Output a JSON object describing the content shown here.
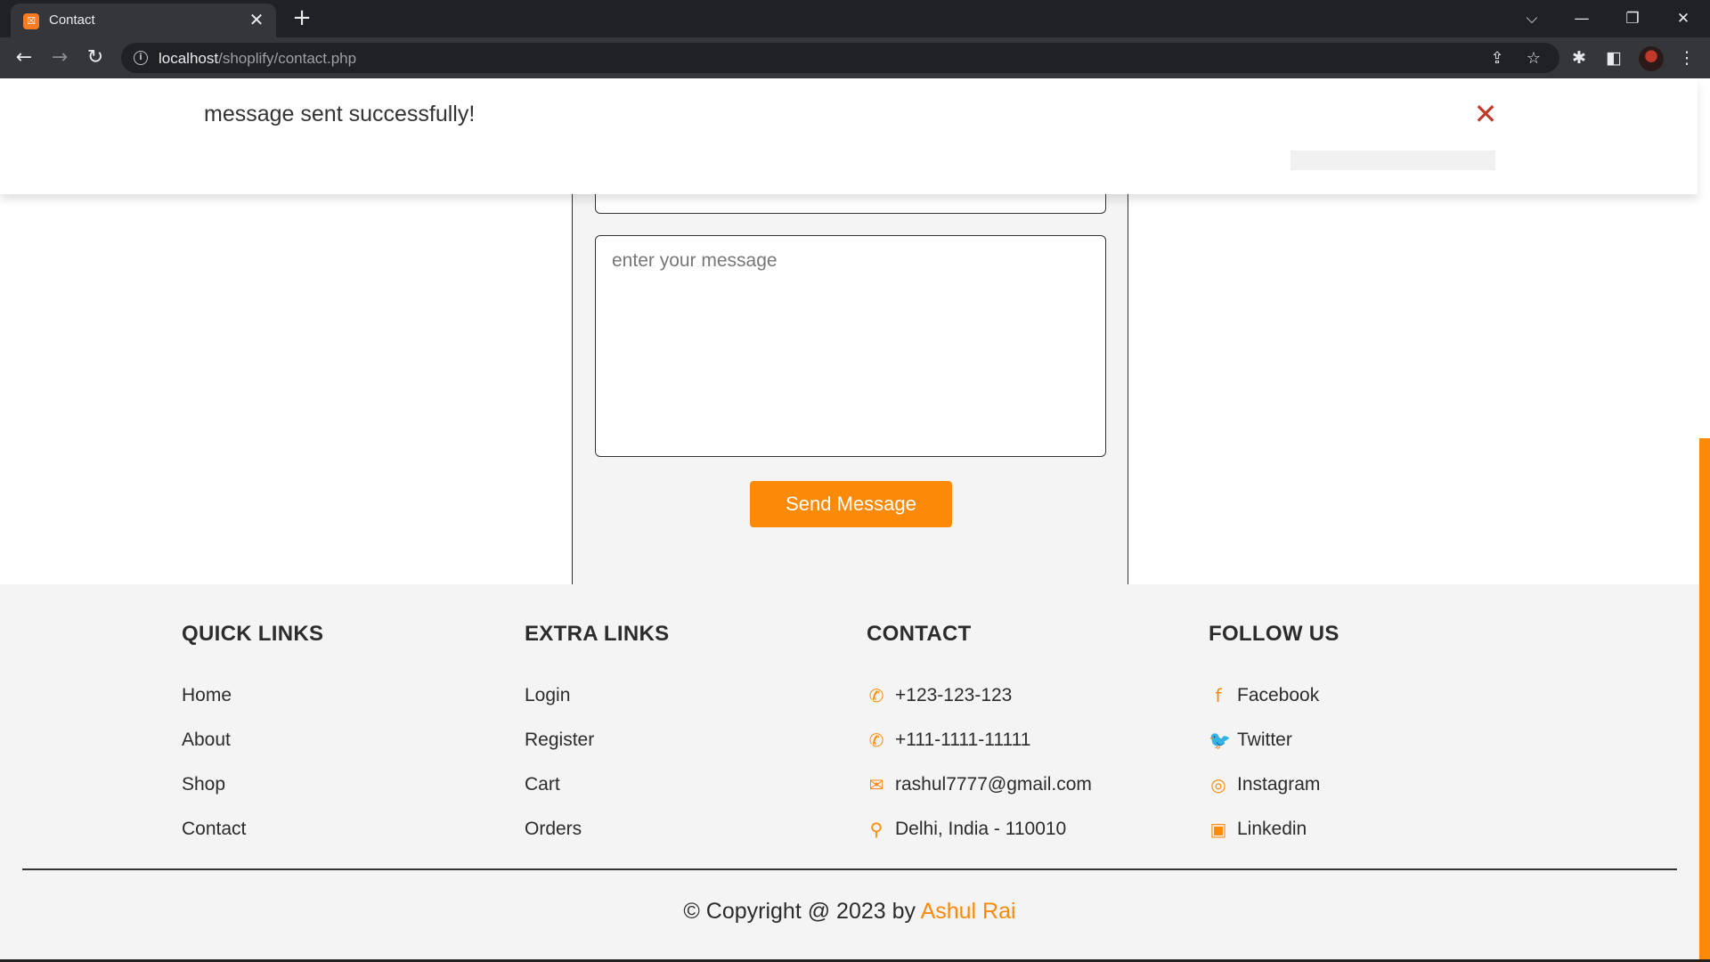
{
  "browser": {
    "tab_title": "Contact",
    "tab_favicon": "xampp-icon",
    "tab_close": "✕",
    "new_tab": "+",
    "window_controls": {
      "dropdown": "⌵",
      "minimize": "—",
      "restore": "❐",
      "close": "✕"
    },
    "nav": {
      "back": "←",
      "forward": "→",
      "reload": "↻"
    },
    "url_host": "localhost",
    "url_path": "/shoplify/contact.php",
    "info": "i",
    "share": "⇪",
    "bookmark": "☆",
    "extensions": "✱",
    "sidepanel": "◧",
    "menu": "⋮"
  },
  "alert": {
    "message": "message sent successfully!",
    "close": "✕"
  },
  "form": {
    "message_placeholder": "enter your message",
    "send_label": "Send Message"
  },
  "footer": {
    "quick_links": {
      "title": "QUICK LINKS",
      "items": [
        "Home",
        "About",
        "Shop",
        "Contact"
      ]
    },
    "extra_links": {
      "title": "EXTRA LINKS",
      "items": [
        "Login",
        "Register",
        "Cart",
        "Orders"
      ]
    },
    "contact": {
      "title": "CONTACT",
      "items": [
        {
          "icon": "phone-icon",
          "glyph": "✆",
          "text": "+123-123-123"
        },
        {
          "icon": "phone-icon",
          "glyph": "✆",
          "text": "+111-1111-11111"
        },
        {
          "icon": "envelope-icon",
          "glyph": "✉",
          "text": "rashul7777@gmail.com"
        },
        {
          "icon": "map-marker-icon",
          "glyph": "⚲",
          "text": "Delhi, India - 110010"
        }
      ]
    },
    "follow_us": {
      "title": "FOLLOW US",
      "items": [
        {
          "icon": "facebook-icon",
          "glyph": "f",
          "text": "Facebook"
        },
        {
          "icon": "twitter-icon",
          "glyph": "🐦",
          "text": "Twitter"
        },
        {
          "icon": "instagram-icon",
          "glyph": "◎",
          "text": "Instagram"
        },
        {
          "icon": "linkedin-icon",
          "glyph": "▣",
          "text": "Linkedin"
        }
      ]
    },
    "copyright_prefix": "© Copyright @ 2023 by ",
    "copyright_author": "Ashul Rai"
  },
  "colors": {
    "accent": "#fb8a09",
    "alert_close": "#c0392b",
    "text": "#2c2c2c",
    "footer_bg": "#f4f4f4"
  }
}
